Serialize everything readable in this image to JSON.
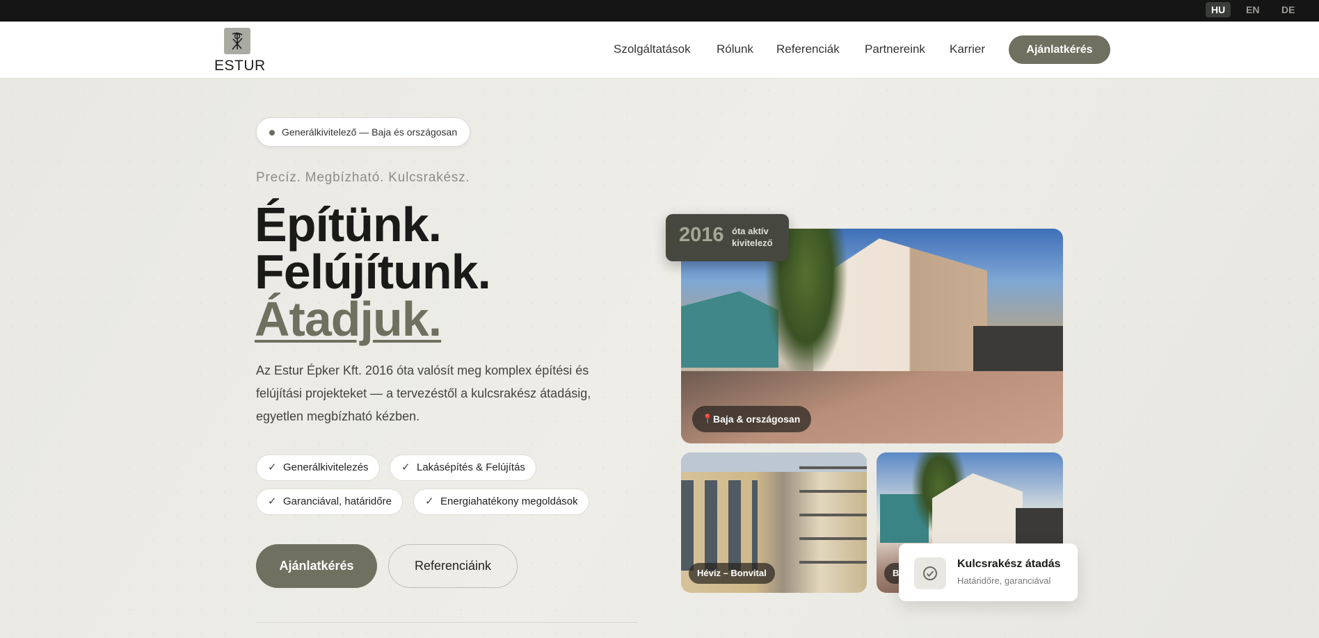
{
  "languages": [
    {
      "code": "HU",
      "active": true
    },
    {
      "code": "EN",
      "active": false
    },
    {
      "code": "DE",
      "active": false
    }
  ],
  "brand": {
    "name": "ESTUR"
  },
  "nav": {
    "items": [
      "Szolgáltatások",
      "Rólunk",
      "Referenciák",
      "Partnereink",
      "Karrier"
    ],
    "cta": "Ajánlatkérés"
  },
  "hero": {
    "badge": "Generálkivitelező — Baja és országosan",
    "tagline": "Precíz. Megbízható. Kulcsrakész.",
    "headline": [
      "Építünk.",
      "Felújítunk.",
      "Átadjuk."
    ],
    "intro": "Az Estur Épker Kft. 2016 óta valósít meg komplex építési és felújítási projekteket — a tervezéstől a kulcsrakész átadásig, egyetlen megbízható kézben.",
    "features": [
      "Generálkivitelezés",
      "Lakásépítés & Felújítás",
      "Garanciával, határidőre",
      "Energiahatékony megoldások"
    ],
    "primary_cta": "Ajánlatkérés",
    "secondary_cta": "Referenciáink"
  },
  "stat": {
    "year": "2016",
    "label_line1": "óta aktív",
    "label_line2": "kivitelező"
  },
  "photos": {
    "main_location": "Baja & országosan",
    "second_location": "Hévíz – Bonvital",
    "third_location": "B"
  },
  "toast": {
    "title": "Kulcsrakész átadás",
    "subtitle": "Határidőre, garanciával"
  },
  "colors": {
    "accent": "#6f705f",
    "dark": "#141514",
    "background": "#ecebe6"
  },
  "icons": {
    "check": "check-icon",
    "pin": "map-pin-icon",
    "toast": "check-circle-icon"
  }
}
